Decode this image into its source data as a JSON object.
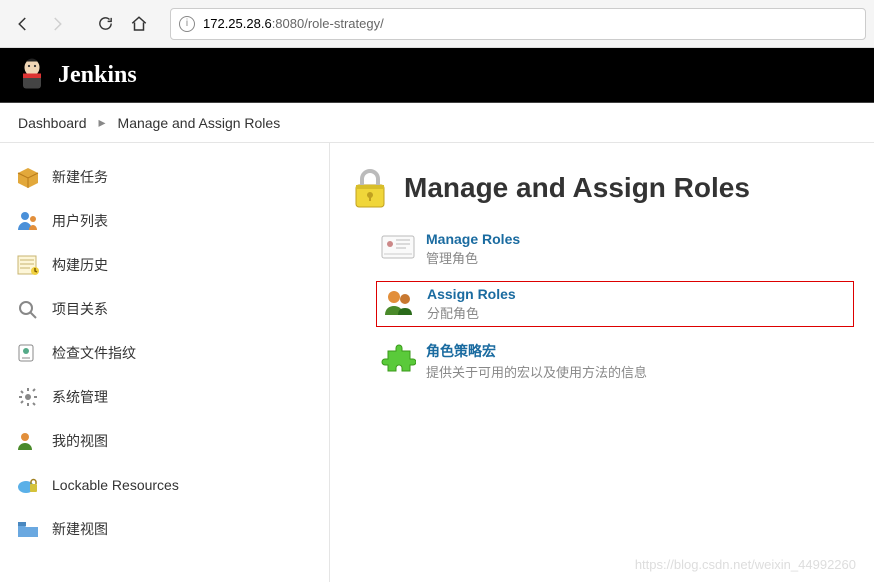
{
  "url": {
    "host": "172.25.28.6",
    "rest": ":8080/role-strategy/"
  },
  "brand": "Jenkins",
  "breadcrumbs": {
    "items": [
      "Dashboard",
      "Manage and Assign Roles"
    ],
    "sep": "▸"
  },
  "sidebar": {
    "items": [
      {
        "icon": "box-icon",
        "label": "新建任务"
      },
      {
        "icon": "user-icon",
        "label": "用户列表"
      },
      {
        "icon": "history-icon",
        "label": "构建历史"
      },
      {
        "icon": "relation-icon",
        "label": "项目关系"
      },
      {
        "icon": "fingerprint-icon",
        "label": "检查文件指纹"
      },
      {
        "icon": "gear-icon",
        "label": "系统管理"
      },
      {
        "icon": "myview-icon",
        "label": "我的视图"
      },
      {
        "icon": "lockres-icon",
        "label": "Lockable Resources"
      },
      {
        "icon": "newview-icon",
        "label": "新建视图"
      }
    ]
  },
  "page": {
    "title": "Manage and Assign Roles",
    "options": [
      {
        "link": "Manage Roles",
        "desc": "管理角色",
        "icon": "badge-icon",
        "highlighted": false
      },
      {
        "link": "Assign Roles",
        "desc": "分配角色",
        "icon": "people-icon",
        "highlighted": true
      },
      {
        "link": "角色策略宏",
        "desc": "提供关于可用的宏以及使用方法的信息",
        "icon": "puzzle-icon",
        "highlighted": false
      }
    ]
  },
  "watermark": "https://blog.csdn.net/weixin_44992260"
}
